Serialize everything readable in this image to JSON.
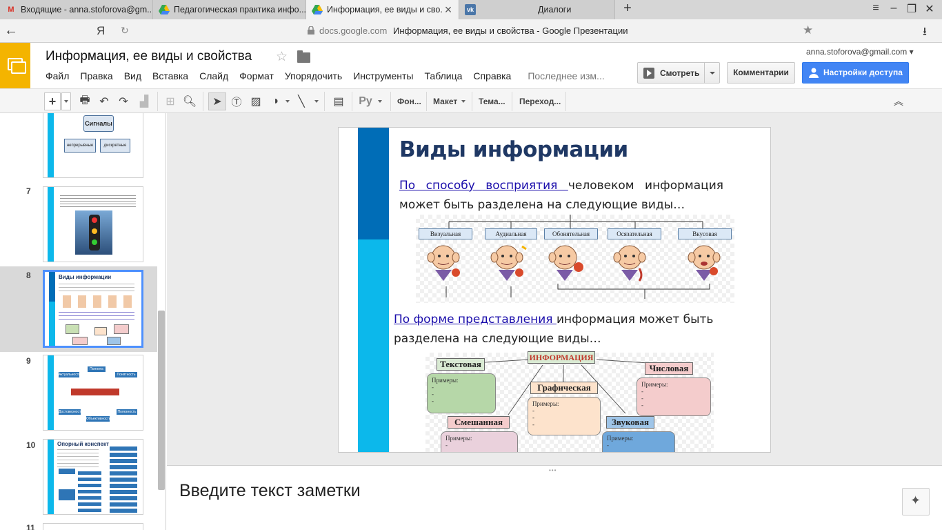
{
  "browser": {
    "tabs": [
      {
        "title": "Входящие - anna.stoforova@gm...",
        "icon": "gmail-icon"
      },
      {
        "title": "Педагогическая практика инфо...",
        "icon": "drive-icon"
      },
      {
        "title": "Информация, ее виды и сво...",
        "icon": "drive-icon",
        "active": true
      },
      {
        "title": "Диалоги",
        "icon": "vk-icon"
      }
    ],
    "new_tab": "+",
    "address": {
      "yandex": "Я",
      "domain": "docs.google.com",
      "page_title": "Информация, ее виды и свойства - Google Презентации"
    }
  },
  "doc": {
    "title": "Информация, ее виды и свойства",
    "account": "anna.stoforova@gmail.com",
    "menus": [
      "Файл",
      "Правка",
      "Вид",
      "Вставка",
      "Слайд",
      "Формат",
      "Упорядочить",
      "Инструменты",
      "Таблица",
      "Справка"
    ],
    "last_edit": "Последнее изм...",
    "present_label": "Смотреть",
    "comments_label": "Комментарии",
    "share_label": "Настройки доступа",
    "accent": "#4285f4",
    "logo_color": "#f4b400"
  },
  "toolbar": {
    "font_label": "Ру",
    "background": "Фон...",
    "layout": "Макет",
    "theme": "Тема...",
    "transition": "Переход..."
  },
  "filmstrip": {
    "slides": [
      {
        "num": "",
        "title": "Сигналы",
        "labels": [
          "непрерывные",
          "дискретные"
        ]
      },
      {
        "num": "7",
        "title": ""
      },
      {
        "num": "8",
        "title": "Виды информации",
        "selected": true
      },
      {
        "num": "9",
        "title": "",
        "labels": [
          "Полнота",
          "Актуальность",
          "Понятность",
          "Достоверность",
          "Объективность",
          "Полезность"
        ]
      },
      {
        "num": "10",
        "title": "Опорный конспект"
      },
      {
        "num": "11",
        "title": ""
      }
    ]
  },
  "slide": {
    "title": "Виды информации",
    "p1_link": "По способу восприятия ",
    "p1_rest": "человеком информация может быть разделена на следующие виды…",
    "perception": [
      "Визуальная",
      "Аудиальная",
      "Обонятельная",
      "Осязательная",
      "Вкусовая"
    ],
    "p2_link": "По форме представления ",
    "p2_rest": "информация может быть разделена на следующие виды…",
    "forms": {
      "center": "ИНФОРМАЦИЯ",
      "text": "Текстовая",
      "numeric": "Числовая",
      "graphic": "Графическая",
      "mixed": "Смешанная",
      "sound": "Звуковая",
      "examples": "Примеры:\n-\n-\n-"
    }
  },
  "notes": {
    "placeholder": "Введите текст заметки"
  }
}
